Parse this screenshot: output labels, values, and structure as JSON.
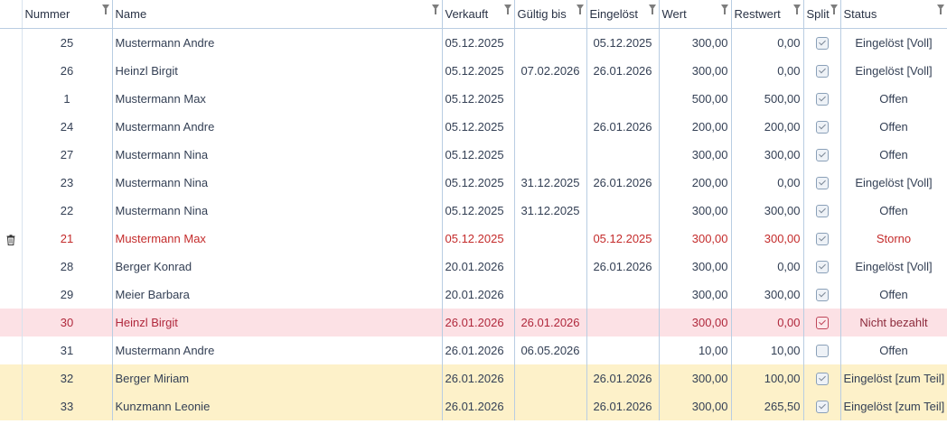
{
  "columns": [
    "Nummer",
    "Name",
    "Verkauft",
    "Gültig bis",
    "Eingelöst",
    "Wert",
    "Restwert",
    "Split",
    "Status"
  ],
  "rows": [
    {
      "nummer": "25",
      "name": "Mustermann Andre",
      "verkauft": "05.12.2025",
      "gueltig": "",
      "eingeloest": "05.12.2025",
      "wert": "300,00",
      "restwert": "0,00",
      "split": true,
      "status": "Eingelöst [Voll]",
      "style": "normal"
    },
    {
      "nummer": "26",
      "name": "Heinzl Birgit",
      "verkauft": "05.12.2025",
      "gueltig": "07.02.2026",
      "eingeloest": "26.01.2026",
      "wert": "300,00",
      "restwert": "0,00",
      "split": true,
      "status": "Eingelöst [Voll]",
      "style": "normal"
    },
    {
      "nummer": "1",
      "name": "Mustermann Max",
      "verkauft": "05.12.2025",
      "gueltig": "",
      "eingeloest": "",
      "wert": "500,00",
      "restwert": "500,00",
      "split": true,
      "status": "Offen",
      "style": "normal"
    },
    {
      "nummer": "24",
      "name": "Mustermann Andre",
      "verkauft": "05.12.2025",
      "gueltig": "",
      "eingeloest": "26.01.2026",
      "wert": "200,00",
      "restwert": "200,00",
      "split": true,
      "status": "Offen",
      "style": "normal"
    },
    {
      "nummer": "27",
      "name": "Mustermann Nina",
      "verkauft": "05.12.2025",
      "gueltig": "",
      "eingeloest": "",
      "wert": "300,00",
      "restwert": "300,00",
      "split": true,
      "status": "Offen",
      "style": "normal"
    },
    {
      "nummer": "23",
      "name": "Mustermann Nina",
      "verkauft": "05.12.2025",
      "gueltig": "31.12.2025",
      "eingeloest": "26.01.2026",
      "wert": "200,00",
      "restwert": "0,00",
      "split": true,
      "status": "Eingelöst [Voll]",
      "style": "normal"
    },
    {
      "nummer": "22",
      "name": "Mustermann Nina",
      "verkauft": "05.12.2025",
      "gueltig": "31.12.2025",
      "eingeloest": "",
      "wert": "300,00",
      "restwert": "300,00",
      "split": true,
      "status": "Offen",
      "style": "normal"
    },
    {
      "nummer": "21",
      "name": "Mustermann Max",
      "verkauft": "05.12.2025",
      "gueltig": "",
      "eingeloest": "05.12.2025",
      "wert": "300,00",
      "restwert": "300,00",
      "split": true,
      "status": "Storno",
      "style": "storno",
      "delete_icon": "trash-icon"
    },
    {
      "nummer": "28",
      "name": "Berger Konrad",
      "verkauft": "20.01.2026",
      "gueltig": "",
      "eingeloest": "26.01.2026",
      "wert": "300,00",
      "restwert": "0,00",
      "split": true,
      "status": "Eingelöst [Voll]",
      "style": "normal"
    },
    {
      "nummer": "29",
      "name": "Meier Barbara",
      "verkauft": "20.01.2026",
      "gueltig": "",
      "eingeloest": "",
      "wert": "300,00",
      "restwert": "300,00",
      "split": true,
      "status": "Offen",
      "style": "normal"
    },
    {
      "nummer": "30",
      "name": "Heinzl Birgit",
      "verkauft": "26.01.2026",
      "gueltig": "26.01.2026",
      "eingeloest": "",
      "wert": "300,00",
      "restwert": "0,00",
      "split": true,
      "status": "Nicht bezahlt",
      "style": "unpaid"
    },
    {
      "nummer": "31",
      "name": "Mustermann Andre",
      "verkauft": "26.01.2026",
      "gueltig": "06.05.2026",
      "eingeloest": "",
      "wert": "10,00",
      "restwert": "10,00",
      "split": false,
      "status": "Offen",
      "style": "normal"
    },
    {
      "nummer": "32",
      "name": "Berger Miriam",
      "verkauft": "26.01.2026",
      "gueltig": "",
      "eingeloest": "26.01.2026",
      "wert": "300,00",
      "restwert": "100,00",
      "split": true,
      "status": "Eingelöst [zum Teil]",
      "style": "partial"
    },
    {
      "nummer": "33",
      "name": "Kunzmann Leonie",
      "verkauft": "26.01.2026",
      "gueltig": "",
      "eingeloest": "26.01.2026",
      "wert": "300,00",
      "restwert": "265,50",
      "split": true,
      "status": "Eingelöst [zum Teil]",
      "style": "partial"
    }
  ],
  "colors": {
    "grid_line": "#b9cde2",
    "storno_text": "#c42b2b",
    "unpaid_row": "#fce1e5",
    "partial_row": "#fdf1c9"
  }
}
